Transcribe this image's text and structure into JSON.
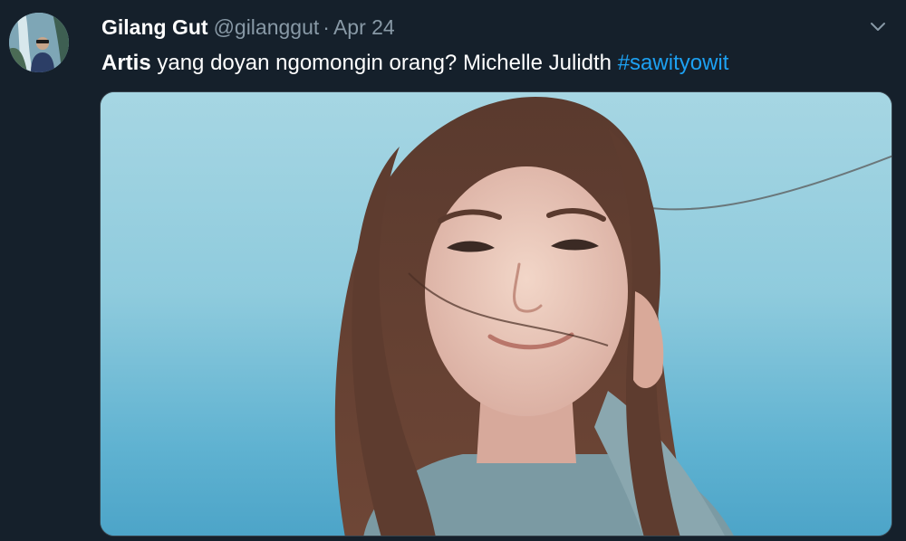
{
  "tweet": {
    "author_name": "Gilang Gut",
    "author_handle": "@gilanggut",
    "separator": "·",
    "date": "Apr 24",
    "text_bold": "Artis",
    "text_body": " yang doyan ngomongin orang? Michelle Julidth ",
    "hashtag": "#sawityowit"
  },
  "icons": {
    "more": "chevron-down-icon",
    "avatar": "avatar"
  },
  "colors": {
    "background": "#15202b",
    "primary_text": "#ffffff",
    "secondary_text": "#8899a6",
    "link": "#1da1f2"
  }
}
